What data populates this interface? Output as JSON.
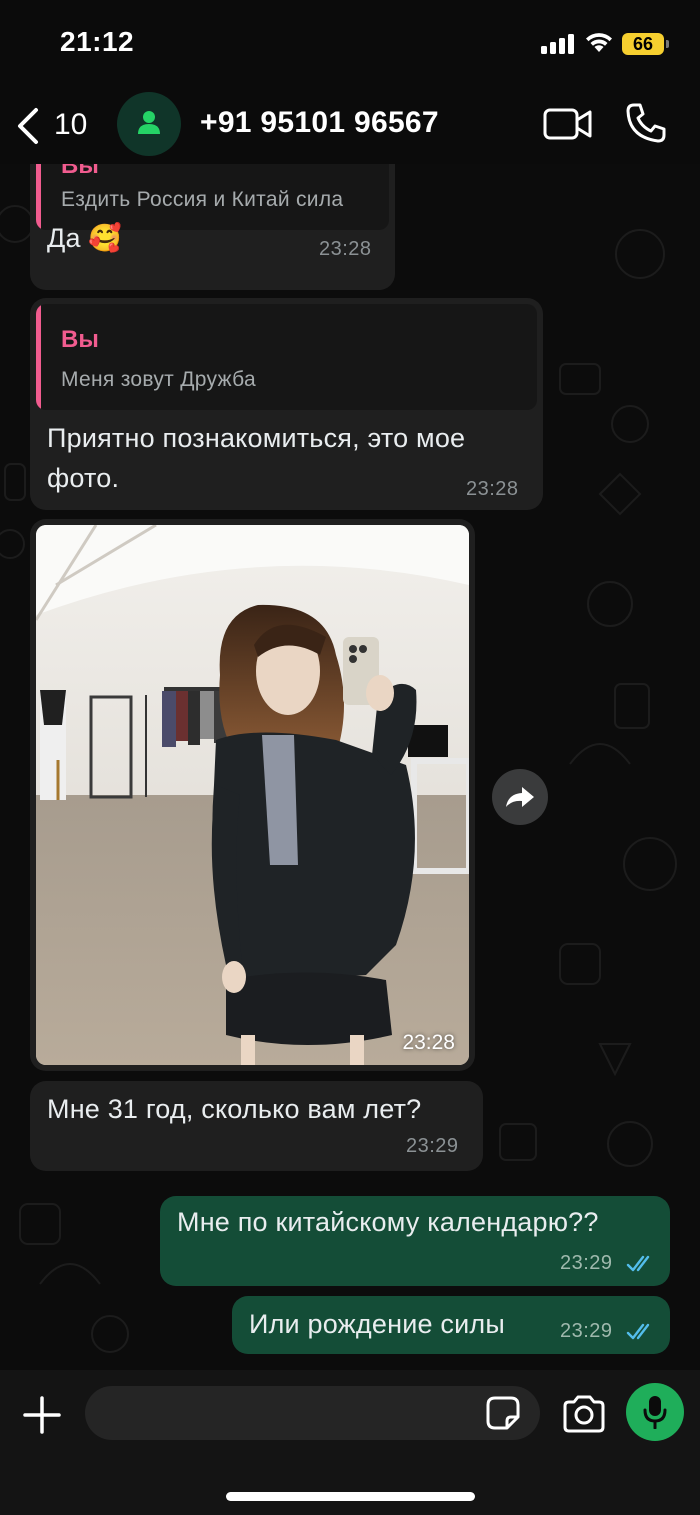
{
  "status_bar": {
    "time": "21:12",
    "battery": "66",
    "battery_color": "#f6cf2f",
    "signal_icon": "cellular-signal-icon",
    "wifi_icon": "wifi-icon"
  },
  "header": {
    "back_count": "10",
    "contact_name": "+91 95101 96567",
    "avatar_icon": "person-icon",
    "video_icon": "video-camera-icon",
    "call_icon": "phone-icon"
  },
  "messages": [
    {
      "direction": "in",
      "quote_author": "Вы",
      "quote_text": "Ездить Россия и Китай сила",
      "text": "Да 🥰",
      "time": "23:28"
    },
    {
      "direction": "in",
      "quote_author": "Вы",
      "quote_text": "Меня зовут Дружба",
      "text_line1": "Приятно познакомиться, это мое",
      "text_line2": "фото.",
      "time": "23:28"
    },
    {
      "direction": "in",
      "type": "photo",
      "time": "23:28",
      "forward_icon": "forward-arrow-icon"
    },
    {
      "direction": "in",
      "text": "Мне 31 год, сколько вам лет?",
      "time": "23:29"
    },
    {
      "direction": "out",
      "text": "Мне по китайскому календарю??",
      "time": "23:29",
      "status_icon": "double-check-read-icon"
    },
    {
      "direction": "out",
      "text": "Или рождение силы",
      "time": "23:29",
      "status_icon": "double-check-read-icon"
    }
  ],
  "composer": {
    "attach_icon": "plus-icon",
    "sticker_icon": "sticker-icon",
    "camera_icon": "camera-icon",
    "mic_icon": "microphone-icon"
  },
  "colors": {
    "incoming_bubble": "#1f1f1f",
    "outgoing_bubble": "#144d37",
    "quote_accent": "#f15c8f",
    "read_ticks": "#53bdeb",
    "mic_button": "#1fae5a"
  }
}
